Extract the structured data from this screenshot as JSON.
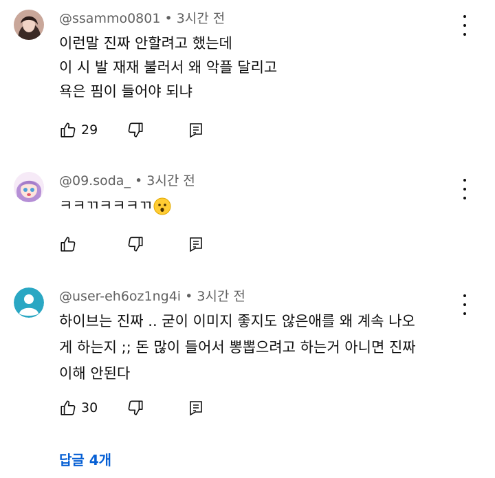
{
  "comments": [
    {
      "handle": "@ssammo0801",
      "time": " • 3시간 전",
      "lines": [
        "이런말 진짜 안할려고 했는데",
        "이 시 발  재재 불러서 왜 악플 달리고",
        "욕은 핌이 들어야 되냐"
      ],
      "likes": "29",
      "avatar_icon": "photo-avatar"
    },
    {
      "handle": "@09.soda_",
      "time": " • 3시간 전",
      "lines": [
        "ㅋㅋㄲㅋㅋㅋㄲ"
      ],
      "emoji": "hushed-face-emoji",
      "likes": "",
      "avatar_icon": "anime-avatar"
    },
    {
      "handle": "@user-eh6oz1ng4i",
      "time": " • 3시간 전",
      "lines": [
        "하이브는 진짜 .. 굳이 이미지 좋지도 않은애를 왜 계속 나오",
        "게 하는지 ;; 돈 많이 들어서 뽕뽑으려고 하는거 아니면 진짜",
        "이해 안된다"
      ],
      "likes": "30",
      "avatar_icon": "default-user-avatar"
    }
  ],
  "replies_label": "답글 4개",
  "colors": {
    "accent": "#065fd4",
    "meta": "#606060",
    "avatar_default": "#2aa7c3"
  }
}
